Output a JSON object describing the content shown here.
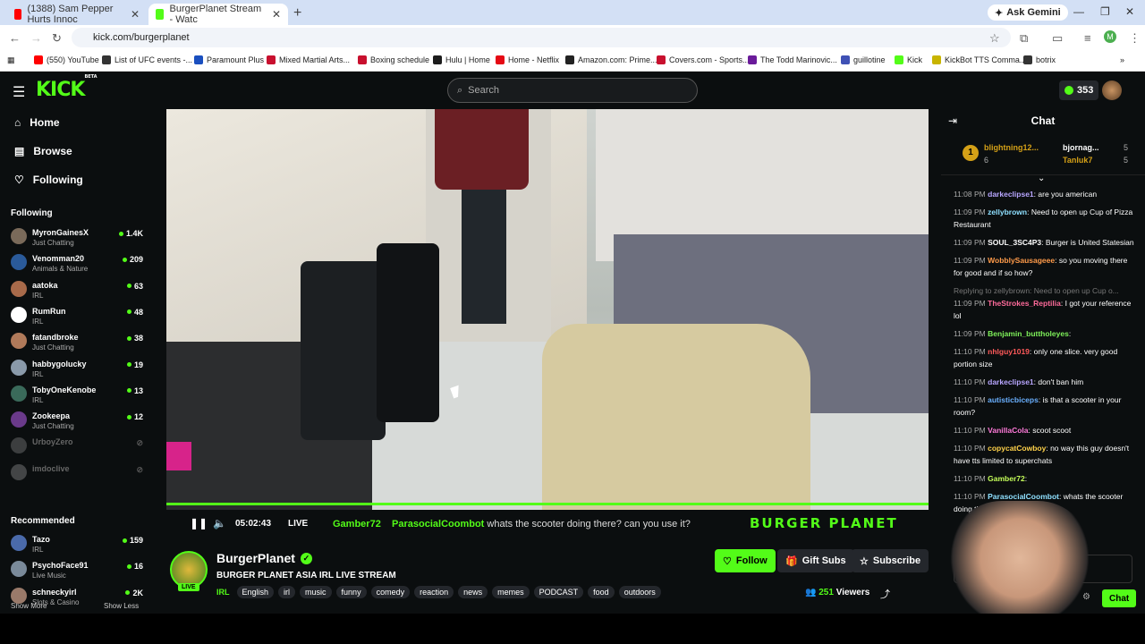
{
  "browser": {
    "tabs": [
      {
        "label": "(1388) Sam Pepper Hurts Innoc",
        "color": "#ff0000"
      },
      {
        "label": "BurgerPlanet Stream - Watc",
        "color": "#53fc18"
      }
    ],
    "gemini": "Ask Gemini",
    "url": "kick.com/burgerplanet",
    "bookmarks": [
      "(550) YouTube",
      "List of UFC events -...",
      "Paramount Plus",
      "Mixed Martial Arts...",
      "Boxing schedule",
      "Hulu | Home",
      "Home - Netflix",
      "Amazon.com: Prime...",
      "Covers.com - Sports...",
      "The Todd Marinovic...",
      "guillotine",
      "Kick",
      "KickBot TTS Comma...",
      "botrix"
    ],
    "bookmark_colors": [
      "#ff0000",
      "#333333",
      "#1a4fbf",
      "#c8102e",
      "#c8102e",
      "#1c1c1c",
      "#e50914",
      "#222222",
      "#c8102e",
      "#6a1b9a",
      "#3f51b5",
      "#53fc18",
      "#c8b400",
      "#333333"
    ]
  },
  "header": {
    "search_placeholder": "Search",
    "points": "353",
    "logo": "KICK",
    "beta": "BETA"
  },
  "nav": {
    "home": "Home",
    "browse": "Browse",
    "following": "Following"
  },
  "sidebar": {
    "following_title": "Following",
    "following": [
      {
        "name": "MyronGainesX",
        "sub": "Just Chatting",
        "count": "1.4K",
        "color": "#7a6a5a"
      },
      {
        "name": "Venomman20",
        "sub": "Animals & Nature",
        "count": "209",
        "color": "#2a5a9a"
      },
      {
        "name": "aatoka",
        "sub": "IRL",
        "count": "63",
        "color": "#a86a4a"
      },
      {
        "name": "RumRun",
        "sub": "IRL",
        "count": "48",
        "color": "#ffffff"
      },
      {
        "name": "fatandbroke",
        "sub": "Just Chatting",
        "count": "38",
        "color": "#b07a5a"
      },
      {
        "name": "habbygolucky",
        "sub": "IRL",
        "count": "19",
        "color": "#8a9aaa"
      },
      {
        "name": "TobyOneKenobe",
        "sub": "IRL",
        "count": "13",
        "color": "#3a6a5a"
      },
      {
        "name": "Zookeepa",
        "sub": "Just Chatting",
        "count": "12",
        "color": "#6a3a8a"
      },
      {
        "name": "UrboyZero",
        "sub": "",
        "count": "",
        "color": "#888888"
      },
      {
        "name": "imdoclive",
        "sub": "",
        "count": "",
        "color": "#999999"
      }
    ],
    "show_more": "Show More",
    "show_less": "Show Less",
    "recommended_title": "Recommended",
    "recommended": [
      {
        "name": "Tazo",
        "sub": "IRL",
        "count": "159",
        "color": "#4a6aaa"
      },
      {
        "name": "PsychoFace91",
        "sub": "Live Music",
        "count": "16",
        "color": "#7a8a9a"
      },
      {
        "name": "schneckyirl",
        "sub": "Slots & Casino",
        "count": "2K",
        "color": "#9a7a6a"
      }
    ]
  },
  "player": {
    "time": "05:02:43",
    "live": "LIVE",
    "ticker_user": "Gamber72",
    "ticker_user2": "ParasocialCoombot",
    "ticker_text": "whats the scooter doing there? can you use it?",
    "brand": "BURGER PLANET"
  },
  "channel": {
    "name": "BurgerPlanet",
    "title": "BURGER PLANET ASIA IRL LIVE STREAM",
    "category": "IRL",
    "live": "LIVE",
    "tags": [
      "English",
      "irl",
      "music",
      "funny",
      "comedy",
      "reaction",
      "news",
      "memes",
      "PODCAST",
      "food",
      "outdoors"
    ],
    "follow": "Follow",
    "gift": "Gift Subs",
    "subscribe": "Subscribe",
    "viewers_count": "251",
    "viewers_label": "Viewers"
  },
  "chat": {
    "title": "Chat",
    "send_label": "Chat",
    "pinned": [
      {
        "rank": "1",
        "name": "blightning12...",
        "count": "6"
      },
      {
        "name": "bjornag...",
        "count": "5"
      },
      {
        "name": "Tanluk7",
        "count": "5"
      }
    ],
    "messages": [
      {
        "time": "11:08 PM",
        "user": "darkeclipse1",
        "color": "#b8a6ff",
        "text": "are you american"
      },
      {
        "time": "11:09 PM",
        "user": "zellybrown",
        "color": "#8fe0ff",
        "text": "Need to open up Cup of Pizza Restaurant"
      },
      {
        "time": "11:09 PM",
        "user": "SOUL_3SC4P3",
        "color": "#ffffff",
        "text": "Burger is United Statesian"
      },
      {
        "time": "11:09 PM",
        "user": "WobblySausageee",
        "color": "#ff9b4a",
        "text": "so you moving there for good and if so how?"
      },
      {
        "time": "11:09 PM",
        "user": "TheStrokes_Reptilia",
        "color": "#ff6b9b",
        "text": "I got your reference lol"
      },
      {
        "time": "11:09 PM",
        "user": "Benjamin_buttholeyes",
        "color": "#7ef05a",
        "text": ""
      },
      {
        "time": "11:10 PM",
        "user": "nhlguy1019",
        "color": "#ff5a5a",
        "text": "only one slice. very good portion size"
      },
      {
        "time": "11:10 PM",
        "user": "darkeclipse1",
        "color": "#b8a6ff",
        "text": "don't ban him"
      },
      {
        "time": "11:10 PM",
        "user": "autisticbiceps",
        "color": "#6ab0ff",
        "text": "is that a scooter in your room?"
      },
      {
        "time": "11:10 PM",
        "user": "VanillaCola",
        "color": "#ff7ad9",
        "text": "scoot scoot"
      },
      {
        "time": "11:10 PM",
        "user": "copycatCowboy",
        "color": "#ffd24a",
        "text": "no way this guy doesn't have tts limited to superchats"
      },
      {
        "time": "11:10 PM",
        "user": "Gamber72",
        "color": "#c6ff5a",
        "text": ""
      },
      {
        "time": "11:10 PM",
        "user": "ParasocialCoombot",
        "color": "#8fe0ff",
        "text": "whats the scooter doing there? can you use it?"
      }
    ],
    "reply_note": "Replying to zellybrown: Need to open up Cup o..."
  }
}
